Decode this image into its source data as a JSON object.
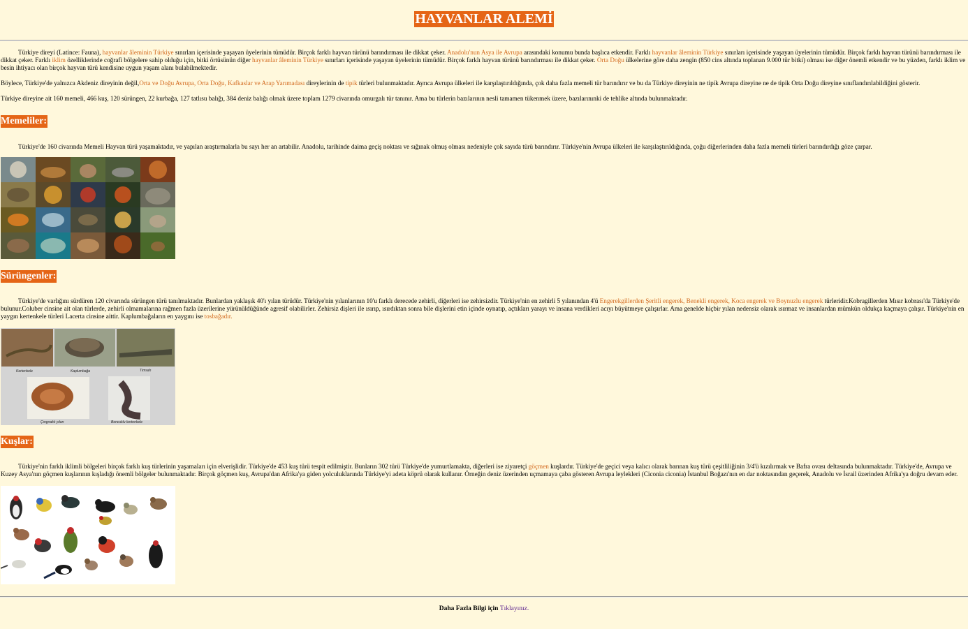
{
  "title": "HAYVANLAR ALEMİ",
  "intro": {
    "p1": [
      {
        "t": "Türkiye direyi (Latince: Fauna), "
      },
      {
        "t": "hayvanlar âleminin Türkiye",
        "link": true
      },
      {
        "t": " sınırları içerisinde yaşayan üyelerinin tümüdür. Birçok farklı hayvan türünü barındırması ile dikkat çeker. "
      },
      {
        "t": "Anadolu'nun Asya ile Avrupa",
        "link": true
      },
      {
        "t": " arasındaki konumu bunda başlıca etkendir. Farklı "
      },
      {
        "t": "hayvanlar âleminin Türkiye",
        "link": true
      },
      {
        "t": " sınırları içerisinde yaşayan üyelerinin tümüdür. Birçok farklı hayvan türünü barındırması ile dikkat çeker. Farklı "
      },
      {
        "t": "iklim",
        "link": true
      },
      {
        "t": " özelliklerinde coğrafi bölgelere sahip olduğu için, bitki örtüsünün diğer "
      },
      {
        "t": "hayvanlar âleminin Türkiye",
        "link": true
      },
      {
        "t": " sınırları içerisinde yaşayan üyelerinin tümüdür. Birçok farklı hayvan türünü barındırması ile dikkat çeker. "
      },
      {
        "t": "Orta Doğu",
        "link": true
      },
      {
        "t": " ülkelerine göre daha zengin (850 cins altında toplanan 9.000 tür bitki) olması ise diğer önemli etkendir ve bu yüzden, farklı iklim ve besin ihtiyacı olan birçok hayvan türü kendisine uygun yaşam alanı bulabilmektedir."
      }
    ],
    "p2": [
      {
        "t": "Böylece, Türkiye'de yalnızca Akdeniz direyinin değil,"
      },
      {
        "t": "Orta ve Doğu Avrupa, Orta Doğu, Kafkaslar ve Arap Yarımadası",
        "link": true
      },
      {
        "t": " direylerinin de "
      },
      {
        "t": "tipik",
        "link": true
      },
      {
        "t": " türleri bulunmaktadır. Ayrıca Avrupa ülkeleri ile karşılaştırıldığında, çok daha fazla memeli tür barındırır ve bu da Türkiye direyinin ne tipik Avrupa direyine ne de tipik Orta Doğu direyine sınıflandırılabildiğini gösterir."
      }
    ],
    "p3": [
      {
        "t": "Türkiye direyine ait 160 memeli, 466 kuş, 120 sürüngen, 22 kurbağa, 127 tatlısu balığı, 384 deniz balığı olmak üzere toplam 1279 civarında omurgalı tür tanınır. Ama bu türlerin bazılarının nesli tamamen tükenmek üzere, bazılarınınki de tehlike altında bulunmaktadır."
      }
    ]
  },
  "memeliler": {
    "heading": "Memeliler:",
    "p": [
      {
        "t": "Türkiye'de 160 civarında Memeli Hayvan türü yaşamaktadır, ve yapılan araştırmalarla bu sayı her an artabilir. Anadolu, tarihinde daima geçiş noktası ve sığınak olmuş olması nedeniyle çok sayıda türü barındırır. Türkiye'nin Avrupa ülkeleri ile karşılaştırıldığında, çoğu diğerlerinden daha fazla memeli türleri barındırdığı göze çarpar."
      }
    ]
  },
  "surungenler": {
    "heading": "Sürüngenler:",
    "p": [
      {
        "t": "Türkiye'de varlığını sürdüren 120 civarında sürüngen türü tanılmaktadır. Bunlardan yaklaşık 40'ı yılan türüdür. Türkiye'nin yılanlarının 10'u farklı derecede zehirli, diğerleri ise zehirsizdir. Türkiye'nin en zehirli 5 yılanından 4'ü "
      },
      {
        "t": "Engerekgillerden Şeritli engerek, Benekli engerek, Koca engerek ve Boynuzlu engerek",
        "link": true
      },
      {
        "t": " türleridir.Kobragillerden Mısır kobrası'da Türkiye'de bulunur.Coluber cinsine ait olan türlerde, zehirli olmamalarına rağmen fazla üzerilerine yürünüldüğünde agresif olabilirler. Zehirsiz dişleri ile ısırıp, ısırdıktan sonra bile dişlerini etin içinde oynatıp, açtıkları yarayı ve insana verdikleri acıyı büyütmeye çalışırlar. Ama genelde hiçbir yılan nedensiz olarak ısırmaz ve insanlardan mümkün oldukça kaçmaya çalışır. Türkiye'nin en yaygın kertenkele türleri Lacerta cinsine aittir. Kaplumbağaların en yaygını ise "
      },
      {
        "t": "tosbağadır.",
        "link": true
      }
    ],
    "captions": [
      "Kertenkele",
      "Kaplumbağa",
      "Timsah",
      "Çıngıraklı yılan",
      "Boncuklu kertenkele"
    ]
  },
  "kuslar": {
    "heading": "Kuşlar:",
    "p": [
      {
        "t": "Türkiye'nin farklı iklimli bölgeleri birçok farklı kuş türlerinin yaşamaları için elverişlidir. Türkiye'de 453 kuş türü tespit edilmiştir. Bunların 302 türü Türkiye'de yumurtlamakta, diğerleri ise ziyaretçi "
      },
      {
        "t": "göçmen",
        "link": true
      },
      {
        "t": " kuşlardır. Türkiye'de geçici veya kalıcı olarak barınan kuş türü çeşitliliğinin 3/4'ü kızılırmak ve Bafra ovası deltasında bulunmaktadır. Türkiye'de, Avrupa ve Kuzey Asya'nın göçmen kuşlarının kışladığı önemli bölgeler bulunmaktadır. Birçok göçmen kuş, Avrupa'dan Afrika'ya giden yolculuklarında Türkiye'yi adeta köprü olarak kullanır. Örneğin deniz üzerinden uçmamaya çaba gösteren Avrupa leylekleri (Ciconia ciconia) İstanbul Boğazı'nın en dar noktasından geçerek, Anadolu ve İsrail üzerinden Afrika'ya doğru devam eder."
      }
    ]
  },
  "footer": {
    "text": "Daha Fazla Bilgi için ",
    "link": "Tıklayınız."
  },
  "colors": {
    "background": "#fff8dc",
    "accent": "#e56516",
    "link": "#d2691e",
    "visited_link": "#551a8b"
  }
}
